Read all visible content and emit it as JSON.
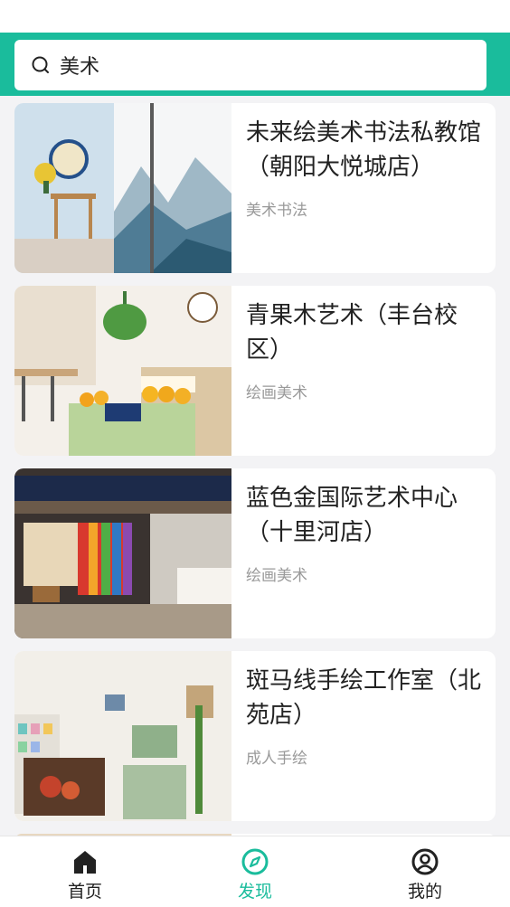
{
  "search": {
    "query": "美术"
  },
  "shops": [
    {
      "title": "未来绘美术书法私教馆（朝阳大悦城店）",
      "tag": "美术书法"
    },
    {
      "title": "青果木艺术（丰台校区）",
      "tag": "绘画美术"
    },
    {
      "title": "蓝色金国际艺术中心（十里河店）",
      "tag": "绘画美术"
    },
    {
      "title": "斑马线手绘工作室（北苑店）",
      "tag": "成人手绘"
    }
  ],
  "tabbar": {
    "home_label": "首页",
    "discover_label": "发现",
    "mine_label": "我的"
  },
  "colors": {
    "accent": "#1abc9c",
    "background": "#f3f3f5"
  }
}
